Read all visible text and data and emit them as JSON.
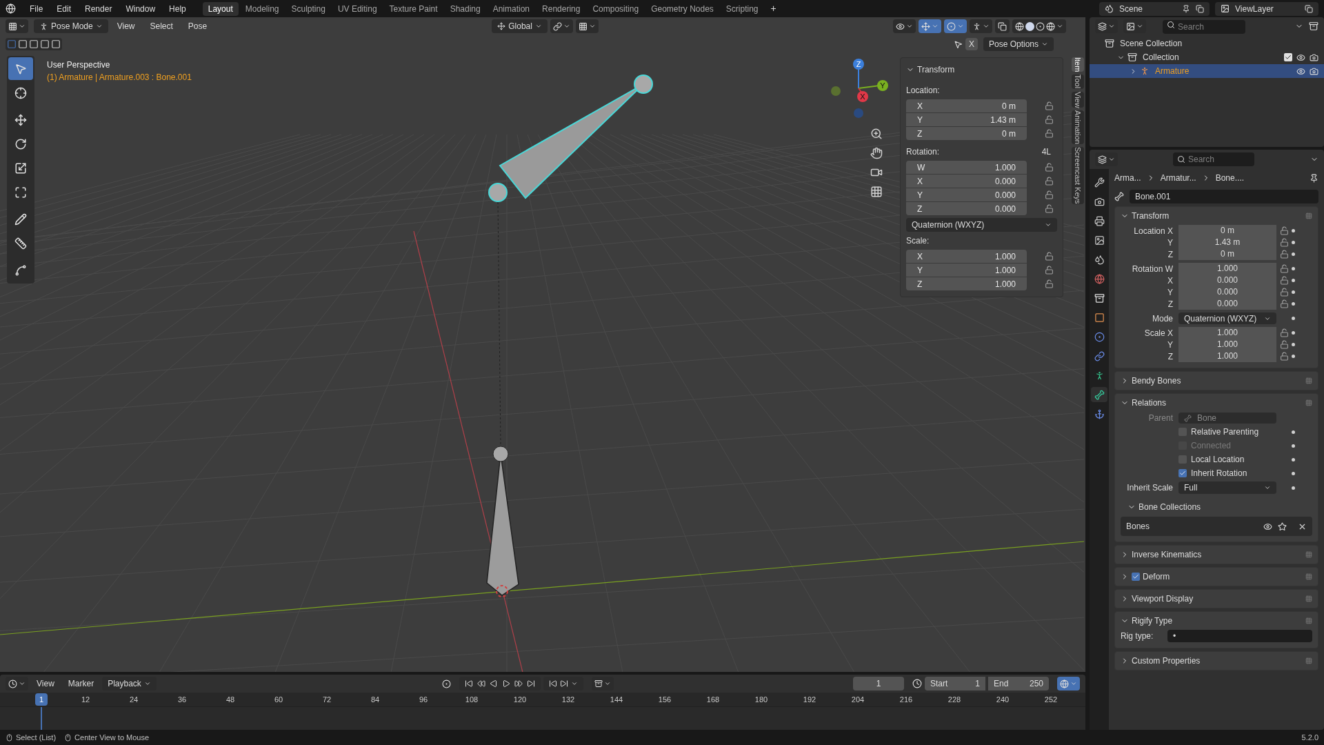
{
  "menus": [
    "File",
    "Edit",
    "Render",
    "Window",
    "Help"
  ],
  "workspaces": [
    {
      "label": "Layout",
      "selected": true
    },
    {
      "label": "Modeling",
      "selected": false
    },
    {
      "label": "Sculpting",
      "selected": false
    },
    {
      "label": "UV Editing",
      "selected": false
    },
    {
      "label": "Texture Paint",
      "selected": false
    },
    {
      "label": "Shading",
      "selected": false
    },
    {
      "label": "Animation",
      "selected": false
    },
    {
      "label": "Rendering",
      "selected": false
    },
    {
      "label": "Compositing",
      "selected": false
    },
    {
      "label": "Geometry Nodes",
      "selected": false
    },
    {
      "label": "Scripting",
      "selected": false
    }
  ],
  "add_tab": "+",
  "scene": "Scene",
  "view_layer": "ViewLayer",
  "viewport": {
    "mode": "Pose Mode",
    "menus": [
      "View",
      "Select",
      "Pose"
    ],
    "orientation": "Global",
    "mirror": "X",
    "pose_options": "Pose Options",
    "view_name": "User Perspective",
    "context": "(1) Armature | Armature.003 : Bone.001",
    "tools": [
      {
        "kind": "select",
        "selected": true
      },
      {
        "kind": "cursor",
        "selected": false
      },
      {
        "kind": "move",
        "selected": false
      },
      {
        "kind": "rotate",
        "selected": false
      },
      {
        "kind": "scale",
        "selected": false
      },
      {
        "kind": "transform",
        "selected": false
      },
      {
        "kind": "annotate",
        "selected": false
      },
      {
        "kind": "measure",
        "selected": false
      },
      {
        "kind": "curve",
        "selected": false
      }
    ],
    "gizmo": {
      "x": "X",
      "y": "Y",
      "z": "Z"
    }
  },
  "n_panel": {
    "title": "Transform",
    "location_label": "Location:",
    "location": [
      {
        "axis": "X",
        "value": "0 m"
      },
      {
        "axis": "Y",
        "value": "1.43 m"
      },
      {
        "axis": "Z",
        "value": "0 m"
      }
    ],
    "rotation_label": "Rotation:",
    "lock_4l": "4L",
    "rotation": [
      {
        "axis": "W",
        "value": "1.000"
      },
      {
        "axis": "X",
        "value": "0.000"
      },
      {
        "axis": "Y",
        "value": "0.000"
      },
      {
        "axis": "Z",
        "value": "0.000"
      }
    ],
    "rotation_mode": "Quaternion (WXYZ)",
    "scale_label": "Scale:",
    "scale": [
      {
        "axis": "X",
        "value": "1.000"
      },
      {
        "axis": "Y",
        "value": "1.000"
      },
      {
        "axis": "Z",
        "value": "1.000"
      }
    ],
    "tabs": [
      {
        "label": "Item",
        "selected": true
      },
      {
        "label": "Tool",
        "selected": false
      },
      {
        "label": "View",
        "selected": false
      },
      {
        "label": "Animation",
        "selected": false
      },
      {
        "label": "Screencast Keys",
        "selected": false
      }
    ]
  },
  "outliner": {
    "search": {
      "placeholder": "Search"
    },
    "items": [
      {
        "label": "Scene Collection",
        "selected": false,
        "children": [
          {
            "label": "Collection",
            "selected": false,
            "checked": true,
            "children": [
              {
                "label": "Armature",
                "selected": true
              }
            ]
          }
        ]
      }
    ]
  },
  "properties": {
    "search": {
      "placeholder": "Search"
    },
    "tabs": [
      {
        "kind": "tool",
        "selected": false
      },
      {
        "kind": "render",
        "selected": false
      },
      {
        "kind": "output",
        "selected": false
      },
      {
        "kind": "view-layer",
        "selected": false
      },
      {
        "kind": "scene",
        "selected": false
      },
      {
        "kind": "world",
        "selected": false
      },
      {
        "kind": "collection",
        "selected": false
      },
      {
        "kind": "object",
        "selected": false
      },
      {
        "kind": "physics",
        "selected": false
      },
      {
        "kind": "constraints",
        "selected": false
      },
      {
        "kind": "data",
        "selected": false
      },
      {
        "kind": "bone",
        "selected": true
      },
      {
        "kind": "bone-constraint",
        "selected": false
      }
    ],
    "breadcrumb": [
      "Arma...",
      "Armatur...",
      "Bone...."
    ],
    "name": "Bone.001",
    "panels": [
      {
        "kind": "transform",
        "title": "Transform",
        "expanded": true,
        "rows": [
          {
            "label": "Location X",
            "value": "0 m"
          },
          {
            "label": "Y",
            "value": "1.43 m"
          },
          {
            "label": "Z",
            "value": "0 m"
          },
          {
            "label": "Rotation W",
            "value": "1.000"
          },
          {
            "label": "X",
            "value": "0.000"
          },
          {
            "label": "Y",
            "value": "0.000"
          },
          {
            "label": "Z",
            "value": "0.000"
          },
          {
            "label": "Mode",
            "value": "Quaternion (WXYZ)"
          },
          {
            "label": "Scale X",
            "value": "1.000"
          },
          {
            "label": "Y",
            "value": "1.000"
          },
          {
            "label": "Z",
            "value": "1.000"
          }
        ]
      },
      {
        "kind": "plain",
        "title": "Bendy Bones",
        "expanded": false
      },
      {
        "kind": "relations",
        "title": "Relations",
        "expanded": true,
        "parent_label": "Parent",
        "parent": "Bone",
        "options": [
          {
            "label": "Relative Parenting",
            "checked": false,
            "disabled": false
          },
          {
            "label": "Connected",
            "checked": false,
            "disabled": true
          },
          {
            "label": "Local Location",
            "checked": false,
            "disabled": false
          },
          {
            "label": "Inherit Rotation",
            "checked": true,
            "disabled": false
          }
        ],
        "inherit_scale_label": "Inherit Scale",
        "inherit_scale": "Full",
        "collections_title": "Bone Collections",
        "collections_expanded": true,
        "collections": [
          "Bones"
        ]
      },
      {
        "kind": "plain",
        "title": "Inverse Kinematics",
        "expanded": false
      },
      {
        "kind": "check",
        "title": "Deform",
        "expanded": false,
        "checked": true
      },
      {
        "kind": "plain",
        "title": "Viewport Display",
        "expanded": false
      },
      {
        "kind": "rigify",
        "title": "Rigify Type",
        "expanded": true,
        "label": "Rig type:",
        "value": "•"
      },
      {
        "kind": "plain",
        "title": "Custom Properties",
        "expanded": false
      }
    ]
  },
  "timeline": {
    "menus": [
      "View",
      "Marker",
      "Playback"
    ],
    "current_frame": "1",
    "start_label": "Start",
    "start": "1",
    "end_label": "End",
    "end": "250",
    "playhead": "1",
    "ticks": [
      "12",
      "24",
      "36",
      "48",
      "60",
      "72",
      "84",
      "96",
      "108",
      "120",
      "132",
      "144",
      "156",
      "168",
      "180",
      "192",
      "204",
      "216",
      "228",
      "240",
      "252"
    ]
  },
  "status_bar": {
    "hints": [
      "Select (List)",
      "Center View to Mouse"
    ],
    "version": "5.2.0"
  }
}
